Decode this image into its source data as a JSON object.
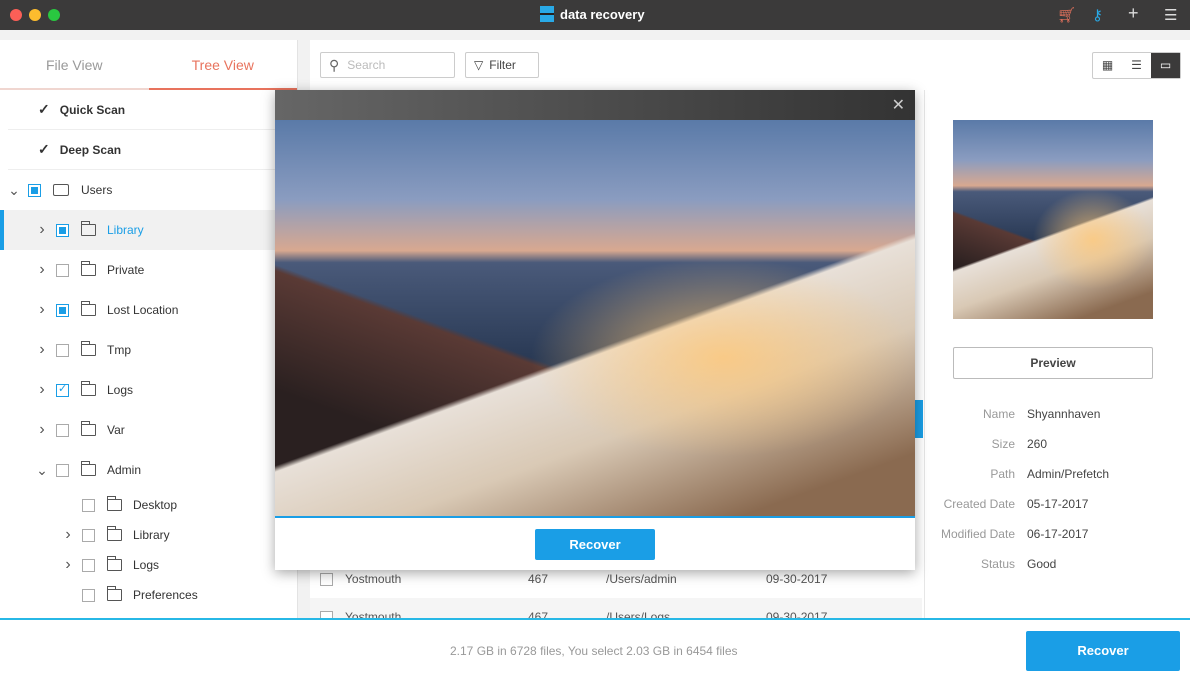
{
  "app": {
    "title": "data recovery",
    "icons": [
      "cart-icon",
      "key-icon",
      "plus-icon",
      "menu-icon"
    ]
  },
  "tabs": [
    {
      "label": "File View"
    },
    {
      "label": "Tree View",
      "active": true
    }
  ],
  "scans": [
    {
      "label": "Quick Scan"
    },
    {
      "label": "Deep Scan"
    }
  ],
  "tree": [
    {
      "label": "Users",
      "level": 0,
      "state": "partial",
      "expanded": true,
      "icon": "drive-icon"
    },
    {
      "label": "Library",
      "level": 1,
      "state": "partial",
      "selected": true
    },
    {
      "label": "Private",
      "level": 1,
      "state": "none"
    },
    {
      "label": "Lost Location",
      "level": 1,
      "state": "partial"
    },
    {
      "label": "Tmp",
      "level": 1,
      "state": "none"
    },
    {
      "label": "Logs",
      "level": 1,
      "state": "checked"
    },
    {
      "label": "Var",
      "level": 1,
      "state": "none"
    },
    {
      "label": "Admin",
      "level": 1,
      "state": "none",
      "expanded": true
    },
    {
      "label": "Desktop",
      "level": 2,
      "state": "none",
      "leaf": true
    },
    {
      "label": "Library",
      "level": 2,
      "state": "none"
    },
    {
      "label": "Logs",
      "level": 2,
      "state": "none"
    },
    {
      "label": "Preferences",
      "level": 2,
      "state": "none",
      "leaf": true
    }
  ],
  "toolbar": {
    "search_placeholder": "Search",
    "filter_label": "Filter"
  },
  "files": [
    {
      "name": "Yostmouth",
      "size": "467",
      "path": "/Users/admin",
      "date": "09-30-2017"
    },
    {
      "name": "Yostmouth",
      "size": "467",
      "path": "/Users/Logs",
      "date": "09-30-2017"
    }
  ],
  "detail": {
    "preview_label": "Preview",
    "props": [
      {
        "k": "Name",
        "v": "Shyannhaven"
      },
      {
        "k": "Size",
        "v": "260"
      },
      {
        "k": "Path",
        "v": "Admin/Prefetch"
      },
      {
        "k": "Created Date",
        "v": "05-17-2017"
      },
      {
        "k": "Modified Date",
        "v": "06-17-2017"
      },
      {
        "k": "Status",
        "v": "Good"
      }
    ]
  },
  "modal": {
    "recover_label": "Recover"
  },
  "footer": {
    "status": "2.17 GB in 6728 files, You select 2.03 GB in 6454 files",
    "recover_label": "Recover"
  },
  "colors": {
    "accent": "#1a9ee6",
    "tab_active": "#e8735d",
    "titlebar": "#3b3a3a"
  }
}
